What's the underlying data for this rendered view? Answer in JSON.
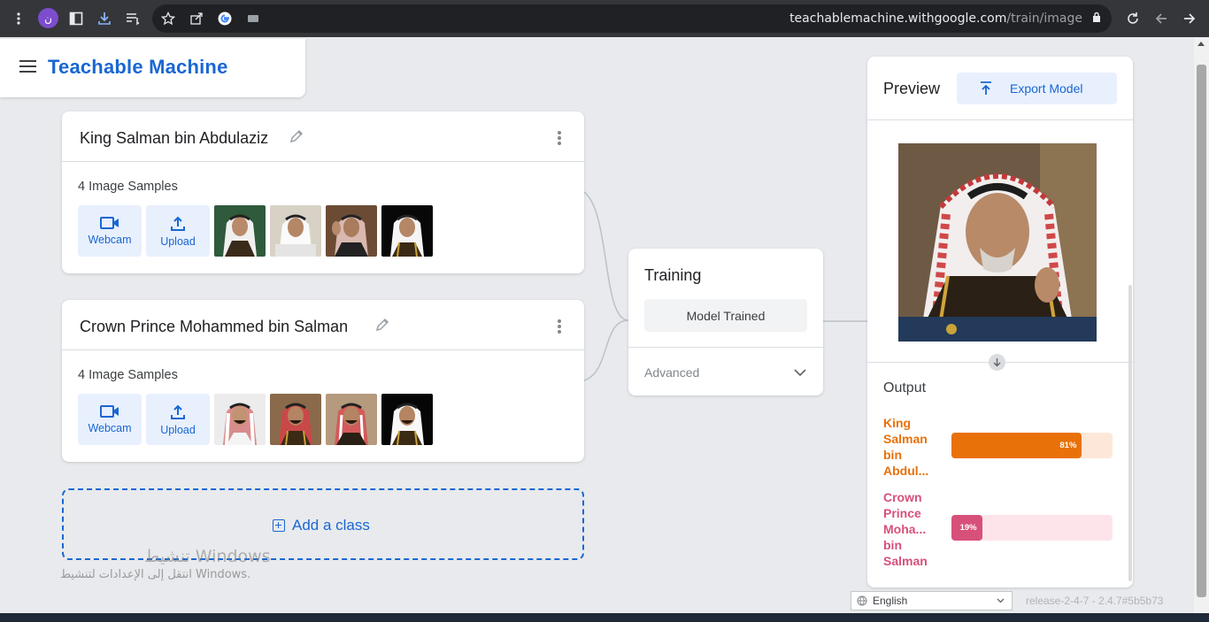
{
  "browser": {
    "profile_initial": "ن",
    "url_host": "teachablemachine.withgoogle.com",
    "url_path": "/train/image"
  },
  "header": {
    "brand": "Teachable Machine"
  },
  "classes": [
    {
      "name": "King Salman bin Abdulaziz",
      "samples_label": "4 Image Samples",
      "webcam_label": "Webcam",
      "upload_label": "Upload"
    },
    {
      "name": "Crown Prince Mohammed bin Salman",
      "samples_label": "4 Image Samples",
      "webcam_label": "Webcam",
      "upload_label": "Upload"
    }
  ],
  "add_class_label": "Add a class",
  "training": {
    "title": "Training",
    "status_button": "Model Trained",
    "advanced_label": "Advanced"
  },
  "preview": {
    "title": "Preview",
    "export_label": "Export Model",
    "output_title": "Output",
    "outputs": [
      {
        "label": "King Salman bin Abdul...",
        "percent_text": "81%",
        "value": 0.81,
        "color": "#e8710a",
        "track": "#fde7d9"
      },
      {
        "label": "Crown Prince Moha... bin Salman",
        "percent_text": "19%",
        "value": 0.19,
        "color": "#d7507a",
        "track": "#fde4ea"
      }
    ]
  },
  "footer": {
    "language": "English",
    "release": "release-2-4-7 - 2.4.7#5b5b73"
  },
  "watermark": {
    "line1": "تنشيط Windows",
    "line2": "انتقل إلى الإعدادات لتنشيط Windows."
  }
}
